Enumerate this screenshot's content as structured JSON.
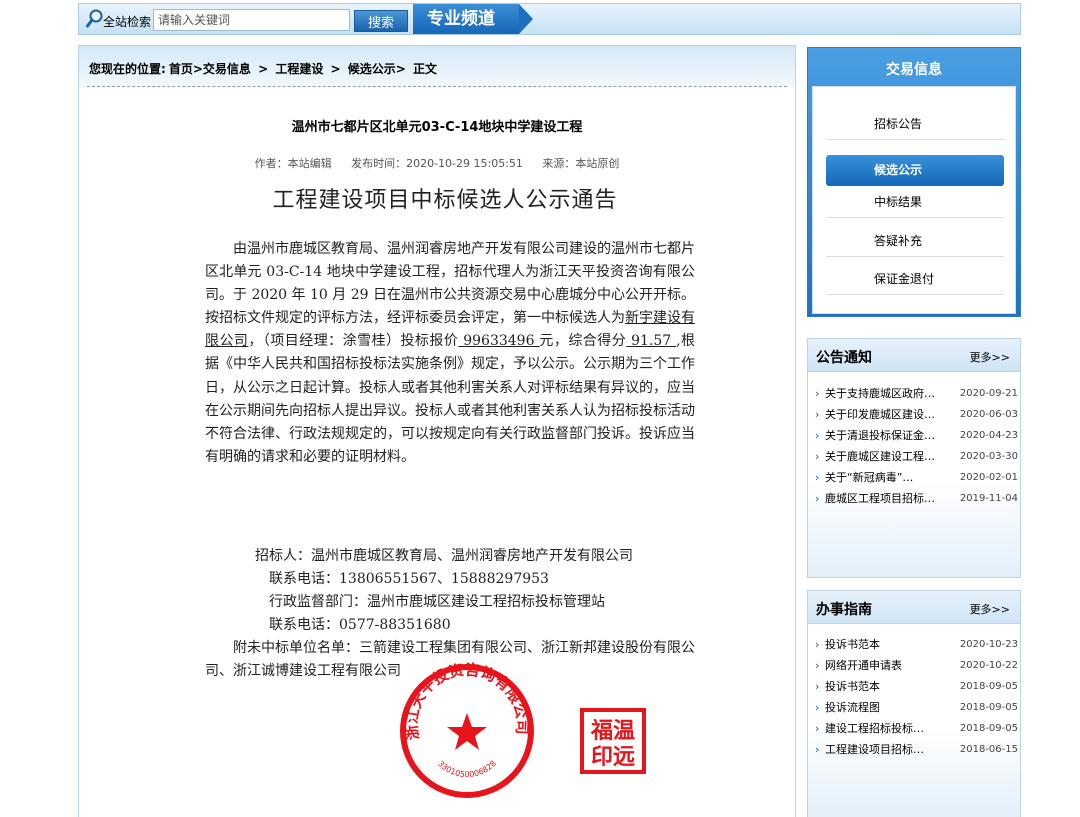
{
  "search": {
    "label": "全站检索",
    "placeholder": "请输入关键词",
    "button": "搜索",
    "channel_tab": "专业频道"
  },
  "breadcrumb": {
    "prefix": "您现在的位置:",
    "items": [
      "首页>交易信息",
      ">",
      "工程建设",
      ">",
      "候选公示>",
      "正文"
    ]
  },
  "article": {
    "title": "温州市七都片区北单元03-C-14地块中学建设工程",
    "author": "作者：本站编辑",
    "publish_time": "发布时间：2020-10-29 15:05:51",
    "source": "来源：本站原创"
  },
  "document": {
    "heading": "工程建设项目中标候选人公示通告",
    "para_1": "由温州市鹿城区教育局、温州润睿房地产开发有限公司建设的温州市七都片区北单元 03-C-14 地块中学建设工程，招标代理人为浙江天平投资咨询有限公司。于 2020 年 10 月 29 日在温州市公共资源交易中心鹿城分中心公开开标。按招标文件规定的评标方法，经评标委员会评定，第一中标候选人为",
    "winner": "新宇建设有限公司",
    "para_2": "，（项目经理：涂雪桂）投标报价",
    "bid_price": " 99633496 ",
    "para_3": "元，综合得分",
    "score": " 91.57 ",
    "para_4": ",根据《中华人民共和国招标投标法实施条例》规定，予以公示。公示期为三个工作日，从公示之日起计算。投标人或者其他利害关系人对评标结果有异议的，应当在公示期间先向招标人提出异议。投标人或者其他利害关系人认为招标投标活动不符合法律、行政法规规定的，可以按规定向有关行政监督部门投诉。投诉应当有明确的请求和必要的证明材料。",
    "tenderer": "招标人：温州市鹿城区教育局、温州润睿房地产开发有限公司",
    "tenderer_phone": "联系电话：13806551567、15888297953",
    "supervisor": "行政监督部门：温州市鹿城区建设工程招标投标管理站",
    "supervisor_phone": "联系电话：0577-88351680",
    "unsuccessful": "附未中标单位名单：三箭建设工程集团有限公司、浙江新邦建设股份有限公司、浙江诚博建设工程有限公司",
    "stamp_round_text": "浙江天平投资咨询有限公司",
    "stamp_number": "3301050006828",
    "stamp_square_text": "福温印远"
  },
  "sidebar": {
    "trade_title": "交易信息",
    "trade_items": [
      {
        "label": "招标公告",
        "active": false
      },
      {
        "label": "候选公示",
        "active": true
      },
      {
        "label": "中标结果",
        "active": false
      },
      {
        "label": "答疑补充",
        "active": false
      },
      {
        "label": "保证金退付",
        "active": false
      }
    ],
    "notice": {
      "title": "公告通知",
      "more": "更多>>",
      "items": [
        {
          "text": "关于支持鹿城区政府采购…",
          "date": "2020-09-21"
        },
        {
          "text": "关于印发鹿城区建设工程…",
          "date": "2020-06-03"
        },
        {
          "text": "关于清退投标保证金的…",
          "date": "2020-04-23"
        },
        {
          "text": "关于鹿城区建设工程…",
          "date": "2020-03-30"
        },
        {
          "text": "关于“新冠病毒”…",
          "date": "2020-02-01"
        },
        {
          "text": "鹿城区工程项目招标…",
          "date": "2019-11-04"
        }
      ]
    },
    "guide": {
      "title": "办事指南",
      "more": "更多>>",
      "items": [
        {
          "text": "投诉书范本",
          "date": "2020-10-23"
        },
        {
          "text": "网络开通申请表",
          "date": "2020-10-22"
        },
        {
          "text": "投诉书范本",
          "date": "2018-09-05"
        },
        {
          "text": "投诉流程图",
          "date": "2018-09-05"
        },
        {
          "text": "建设工程招标投标…",
          "date": "2018-09-05"
        },
        {
          "text": "工程建设项目招标…",
          "date": "2018-06-15"
        }
      ]
    }
  },
  "colors": {
    "accent_blue": "#1f72c0",
    "stamp_red": "#e8141b"
  }
}
